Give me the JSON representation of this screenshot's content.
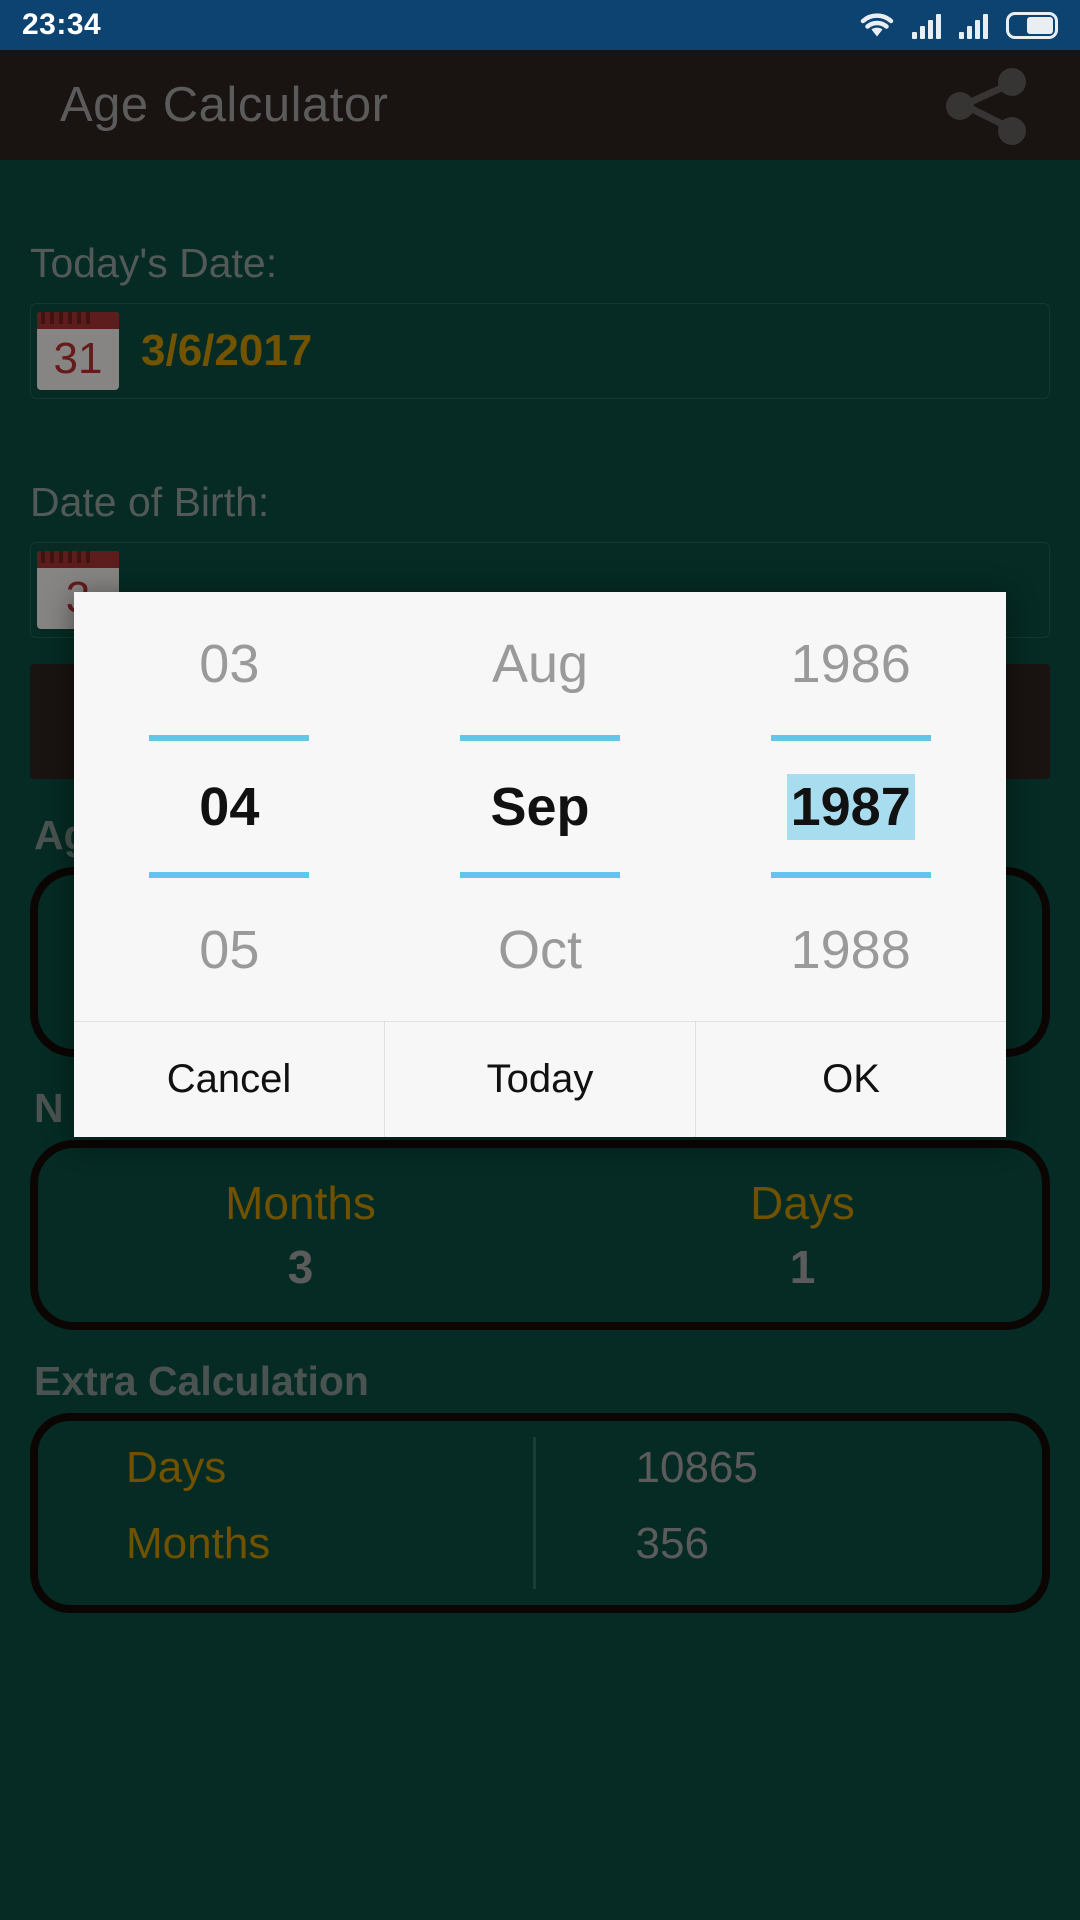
{
  "status_bar": {
    "clock": "23:34",
    "icons": [
      "wifi-icon",
      "signal-icon",
      "signal-icon",
      "battery-icon"
    ]
  },
  "app_bar": {
    "title": "Age Calculator",
    "share_icon": "share-icon"
  },
  "main": {
    "today_label": "Today's Date:",
    "today_icon_day": "31",
    "today_value": "3/6/2017",
    "dob_label": "Date of Birth:",
    "dob_icon_day": "3",
    "dob_value": "",
    "calculate_label": "",
    "age_section_title": "Ag",
    "next_section_title": "N",
    "age_results": [
      {
        "key": "Months",
        "value": "3"
      },
      {
        "key": "Days",
        "value": "1"
      }
    ],
    "extra_title": "Extra Calculation",
    "extra_rows": [
      {
        "key": "Days",
        "value": "10865"
      },
      {
        "key": "Months",
        "value": "356"
      }
    ]
  },
  "dialog": {
    "columns": [
      {
        "name": "day",
        "prev": "03",
        "selected": "04",
        "next": "05"
      },
      {
        "name": "month",
        "prev": "Aug",
        "selected": "Sep",
        "next": "Oct"
      },
      {
        "name": "year",
        "prev": "1986",
        "selected": "1987",
        "next": "1988"
      }
    ],
    "buttons": {
      "cancel": "Cancel",
      "today": "Today",
      "ok": "OK"
    }
  },
  "colors": {
    "status_bar": "#0d4370",
    "app_bar": "#2b211e",
    "background": "#0a4a3e",
    "accent_gold": "#c59200",
    "picker_divider": "#63c5e8",
    "selection_highlight": "#a8dcef"
  }
}
